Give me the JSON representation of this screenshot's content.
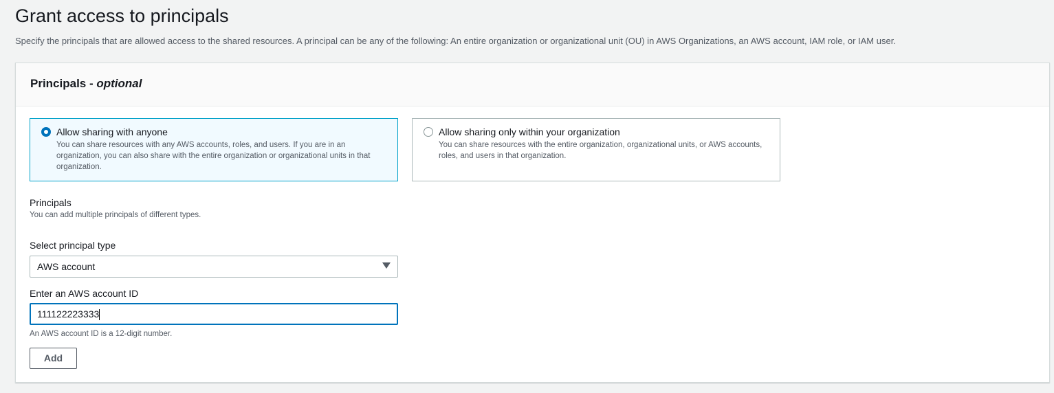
{
  "page": {
    "title": "Grant access to principals",
    "description": "Specify the principals that are allowed access to the shared resources. A principal can be any of the following: An entire organization or organizational unit (OU) in AWS Organizations, an AWS account, IAM role, or IAM user."
  },
  "card": {
    "title": "Principals",
    "title_suffix": "optional",
    "options": [
      {
        "label": "Allow sharing with anyone",
        "description": "You can share resources with any AWS accounts, roles, and users. If you are in an organization, you can also share with the entire organization or organizational units in that organization.",
        "selected": true
      },
      {
        "label": "Allow sharing only within your organization",
        "description": "You can share resources with the entire organization, organizational units, or AWS accounts, roles, and users in that organization.",
        "selected": false
      }
    ],
    "principals_label": "Principals",
    "principals_hint": "You can add multiple principals of different types.",
    "type_label": "Select principal type",
    "type_value": "AWS account",
    "id_label": "Enter an AWS account ID",
    "id_value": "111122223333",
    "id_hint": "An AWS account ID is a 12-digit number.",
    "add_label": "Add"
  }
}
